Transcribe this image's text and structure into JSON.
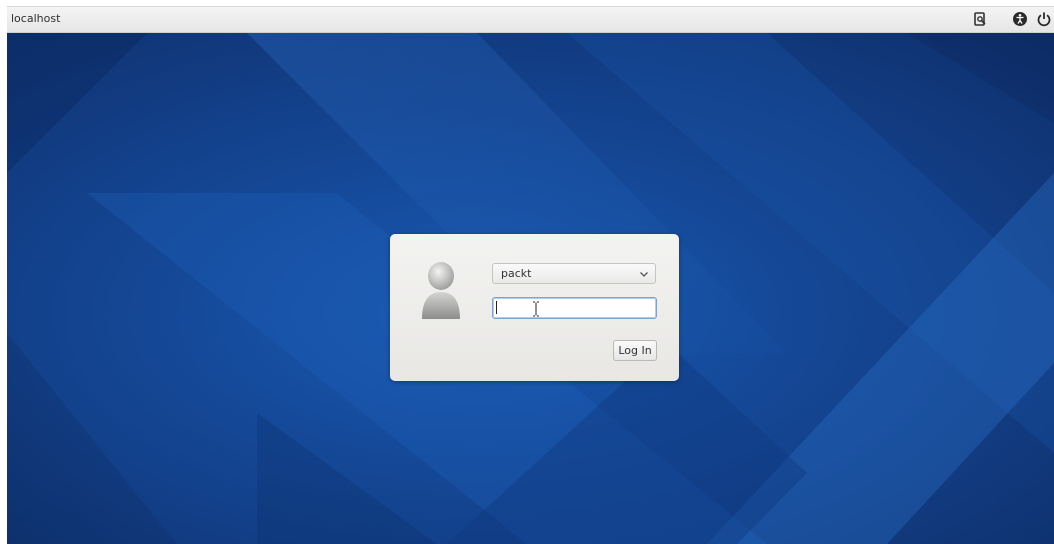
{
  "topbar": {
    "hostname": "localhost",
    "icons": [
      "accessibility-doc-icon",
      "accessibility-icon",
      "power-icon"
    ]
  },
  "login": {
    "selected_user": "packt",
    "password_value": "",
    "login_label": "Log In"
  },
  "colors": {
    "desktop_background": "#154a9a",
    "dialog_background": "#efeeeb",
    "focus_border": "#7da2ce"
  }
}
